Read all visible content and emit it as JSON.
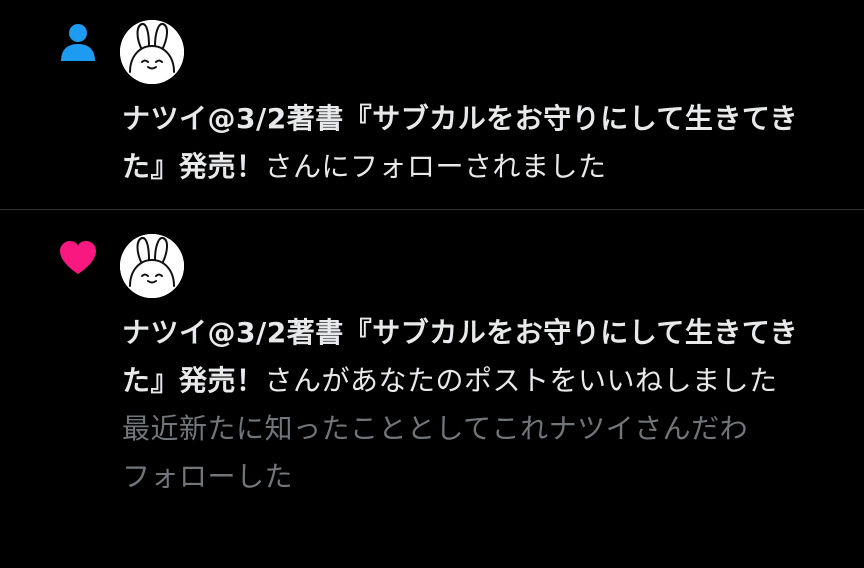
{
  "colors": {
    "background": "#000000",
    "primary_text": "#e7e9ea",
    "secondary_text": "#71767b",
    "follow_icon": "#1d9bf0",
    "like_icon": "#f91880",
    "divider": "#2f3336"
  },
  "notifications": [
    {
      "type_icon": "person-icon",
      "avatar": "bunny-avatar",
      "user_name": "ナツイ@3/2著書『サブカルをお守りにして生きてきた』発売！",
      "action_text": "さんにフォローされました"
    },
    {
      "type_icon": "heart-icon",
      "avatar": "bunny-avatar",
      "user_name": "ナツイ@3/2著書『サブカルをお守りにして生きてきた』発売！",
      "action_text": "さんがあなたのポストをいいねしました",
      "post_preview": "最近新たに知ったこととしてこれナツイさんだわ\nフォローした"
    }
  ]
}
